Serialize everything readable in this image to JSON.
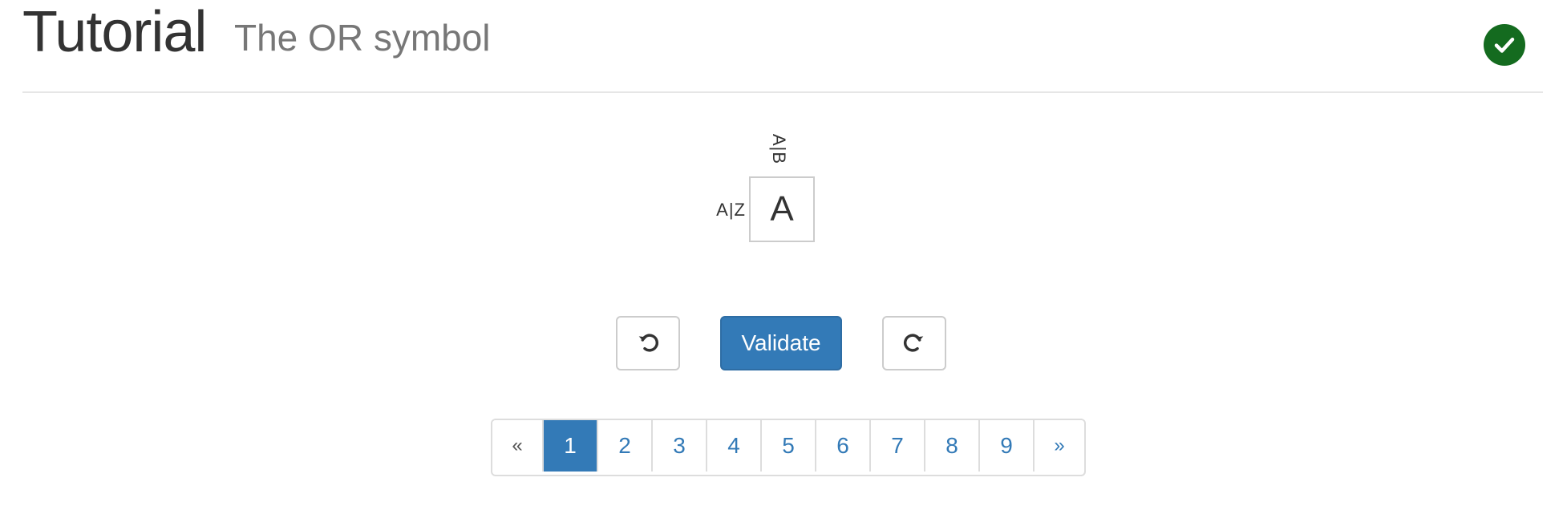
{
  "header": {
    "title": "Tutorial",
    "subtitle": "The OR symbol",
    "status_icon": "check-circle-icon",
    "status_color": "#146b1f"
  },
  "puzzle": {
    "column_clue": "A|B",
    "row_clue": "A|Z",
    "cell_value": "A"
  },
  "controls": {
    "undo_icon": "undo-icon",
    "validate_label": "Validate",
    "redo_icon": "redo-icon",
    "accent_color": "#337ab7"
  },
  "pagination": {
    "prev_label": "«",
    "next_label": "»",
    "pages": [
      "1",
      "2",
      "3",
      "4",
      "5",
      "6",
      "7",
      "8",
      "9"
    ],
    "active_page": "1"
  }
}
